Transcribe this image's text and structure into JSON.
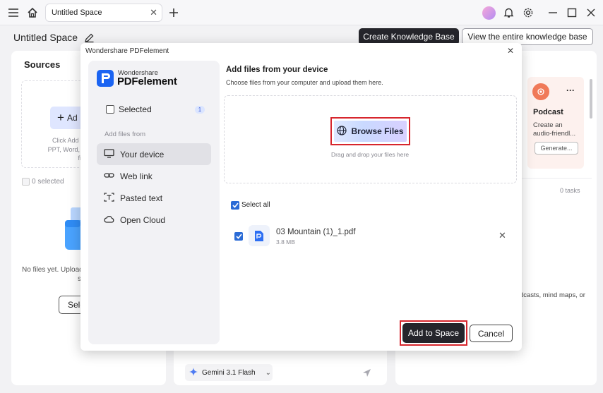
{
  "titlebar": {
    "tab_title": "Untitled Space"
  },
  "header": {
    "space_title": "Untitled Space",
    "create_kb_label": "Create Knowledge Base",
    "view_kb_label": "View the entire knowledge base"
  },
  "sources": {
    "title": "Sources",
    "add_label": "Ad",
    "hint_lines": [
      "Click Add Sources",
      "PPT, Word, images,",
      "files from"
    ],
    "selected_count": "0 selected",
    "empty_text": "No files yet. Upload",
    "empty_text2": "s",
    "select_label": "Sele"
  },
  "studio": {
    "podcast_title": "Podcast",
    "podcast_desc1": "Create an",
    "podcast_desc2": "audio-friendl...",
    "generate_label": "Generate...",
    "tasks": "0 tasks",
    "footer_text": "dcasts, mind maps, or"
  },
  "chat": {
    "model_label": "Gemini 3.1 Flash"
  },
  "modal": {
    "title": "Wondershare PDFelement",
    "brand_top": "Wondershare",
    "brand_name": "PDFelement",
    "selected_label": "Selected",
    "selected_count": "1",
    "add_files_from": "Add files from",
    "items": [
      {
        "label": "Your device"
      },
      {
        "label": "Web link"
      },
      {
        "label": "Pasted text"
      },
      {
        "label": "Open Cloud"
      }
    ],
    "heading": "Add files from your device",
    "subheading": "Choose files from your computer and upload them here.",
    "browse_label": "Browse Files",
    "drag_hint": "Drag and drop your files here",
    "select_all": "Select all",
    "file": {
      "name": "03 Mountain (1)_1.pdf",
      "size": "3.8 MB"
    },
    "add_to_space": "Add to Space",
    "cancel": "Cancel"
  }
}
